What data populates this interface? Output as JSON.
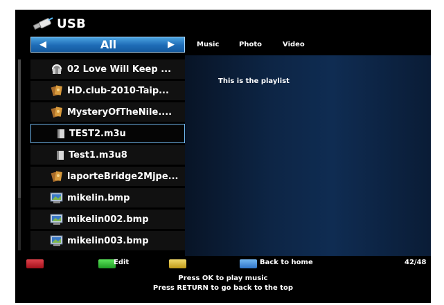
{
  "header": {
    "title": "USB",
    "icon": "usb-stick-icon"
  },
  "filter": {
    "current": "All",
    "prev_icon": "arrow-left-icon",
    "next_icon": "arrow-right-icon"
  },
  "tabs": [
    {
      "label": "Music"
    },
    {
      "label": "Photo"
    },
    {
      "label": "Video"
    }
  ],
  "files": [
    {
      "name": "02 Love Will Keep ...",
      "icon": "music-file-icon",
      "selected": false
    },
    {
      "name": "HD.club-2010-Taip...",
      "icon": "video-file-icon",
      "selected": false
    },
    {
      "name": "MysteryOfTheNile....",
      "icon": "video-file-icon",
      "selected": false
    },
    {
      "name": "TEST2.m3u",
      "icon": "playlist-file-icon",
      "selected": true
    },
    {
      "name": "Test1.m3u8",
      "icon": "playlist-file-icon",
      "selected": false
    },
    {
      "name": "laporteBridge2Mjpe...",
      "icon": "video-file-icon",
      "selected": false
    },
    {
      "name": "mikelin.bmp",
      "icon": "image-file-icon",
      "selected": false
    },
    {
      "name": "mikelin002.bmp",
      "icon": "image-file-icon",
      "selected": false
    },
    {
      "name": "mikelin003.bmp",
      "icon": "image-file-icon",
      "selected": false
    }
  ],
  "preview": {
    "text": "This is the playlist"
  },
  "footer": {
    "red_key_label": "",
    "green_key_label": "Edit",
    "yellow_key_label": "",
    "blue_key_label": "Back to home",
    "page_count": "42/48",
    "hint_line_1": "Press OK to play music",
    "hint_line_2": "Press RETURN to go back to the top"
  },
  "colors": {
    "accent": "#1e6bb6",
    "selection_border": "#6fb6ec",
    "red_key": "#c22830",
    "green_key": "#33b838",
    "yellow_key": "#d9b83a",
    "blue_key": "#4a93dc"
  }
}
